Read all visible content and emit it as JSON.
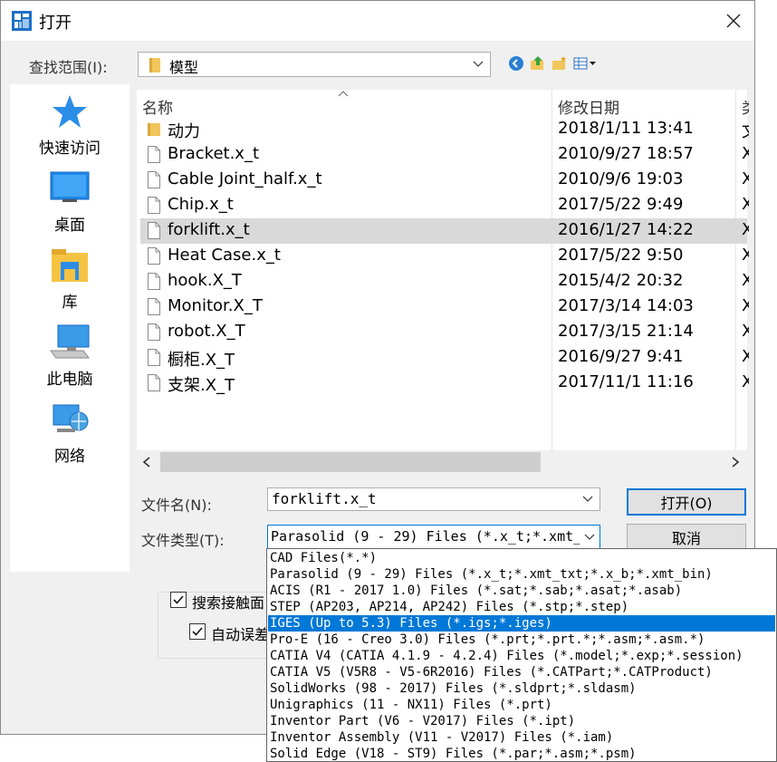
{
  "window": {
    "title": "打开",
    "close_glyph": "✕"
  },
  "lookin": {
    "label": "查找范围(I):",
    "value": "模型"
  },
  "places": [
    {
      "label": "快速访问",
      "icon": "star-icon"
    },
    {
      "label": "桌面",
      "icon": "desktop-icon"
    },
    {
      "label": "库",
      "icon": "library-icon"
    },
    {
      "label": "此电脑",
      "icon": "computer-icon"
    },
    {
      "label": "网络",
      "icon": "network-icon"
    }
  ],
  "filelist": {
    "columns": {
      "name": "名称",
      "date": "修改日期",
      "type": "类"
    },
    "rows": [
      {
        "name": "动力",
        "date": "2018/1/11 13:41",
        "type": "文",
        "kind": "folder"
      },
      {
        "name": "Bracket.x_t",
        "date": "2010/9/27 18:57",
        "type": "X",
        "kind": "file"
      },
      {
        "name": "Cable Joint_half.x_t",
        "date": "2010/9/6 19:03",
        "type": "X",
        "kind": "file"
      },
      {
        "name": "Chip.x_t",
        "date": "2017/5/22 9:49",
        "type": "X",
        "kind": "file"
      },
      {
        "name": "forklift.x_t",
        "date": "2016/1/27 14:22",
        "type": "X",
        "kind": "file",
        "selected": true
      },
      {
        "name": "Heat Case.x_t",
        "date": "2017/5/22 9:50",
        "type": "X",
        "kind": "file"
      },
      {
        "name": "hook.X_T",
        "date": "2015/4/2 20:32",
        "type": "X",
        "kind": "file"
      },
      {
        "name": "Monitor.X_T",
        "date": "2017/3/14 14:03",
        "type": "X",
        "kind": "file"
      },
      {
        "name": "robot.X_T",
        "date": "2017/3/15 21:14",
        "type": "X",
        "kind": "file"
      },
      {
        "name": "橱柜.X_T",
        "date": "2016/9/27 9:41",
        "type": "X",
        "kind": "file"
      },
      {
        "name": "支架.X_T",
        "date": "2017/11/1 11:16",
        "type": "X",
        "kind": "file"
      }
    ]
  },
  "filename": {
    "label": "文件名(N):",
    "value": "forklift.x_t"
  },
  "filetype": {
    "label": "文件类型(T):",
    "value": "Parasolid (9 - 29) Files (*.x_t;*.xmt_",
    "options": [
      "CAD Files(*.*)",
      "Parasolid (9 - 29) Files (*.x_t;*.xmt_txt;*.x_b;*.xmt_bin)",
      "ACIS (R1 - 2017 1.0) Files (*.sat;*.sab;*.asat;*.asab)",
      "STEP (AP203, AP214, AP242) Files (*.stp;*.step)",
      "IGES (Up to 5.3) Files (*.igs;*.iges)",
      "Pro-E (16 - Creo 3.0) Files (*.prt;*.prt.*;*.asm;*.asm.*)",
      "CATIA V4 (CATIA 4.1.9 - 4.2.4) Files (*.model;*.exp;*.session)",
      "CATIA V5 (V5R8 - V5-6R2016) Files (*.CATPart;*.CATProduct)",
      "SolidWorks (98 - 2017) Files (*.sldprt;*.sldasm)",
      "Unigraphics (11 - NX11) Files (*.prt)",
      "Inventor Part (V6 - V2017) Files (*.ipt)",
      "Inventor Assembly (V11 - V2017) Files (*.iam)",
      "Solid Edge (V18 - ST9) Files (*.par;*.asm;*.psm)"
    ],
    "highlighted_index": 4
  },
  "buttons": {
    "open": "打开(O)",
    "cancel": "取消"
  },
  "options": {
    "search_contact": "搜索接触面",
    "auto_tolerance": "自动误差"
  },
  "colors": {
    "accent": "#0078d7",
    "selection": "#d9d9d9"
  }
}
